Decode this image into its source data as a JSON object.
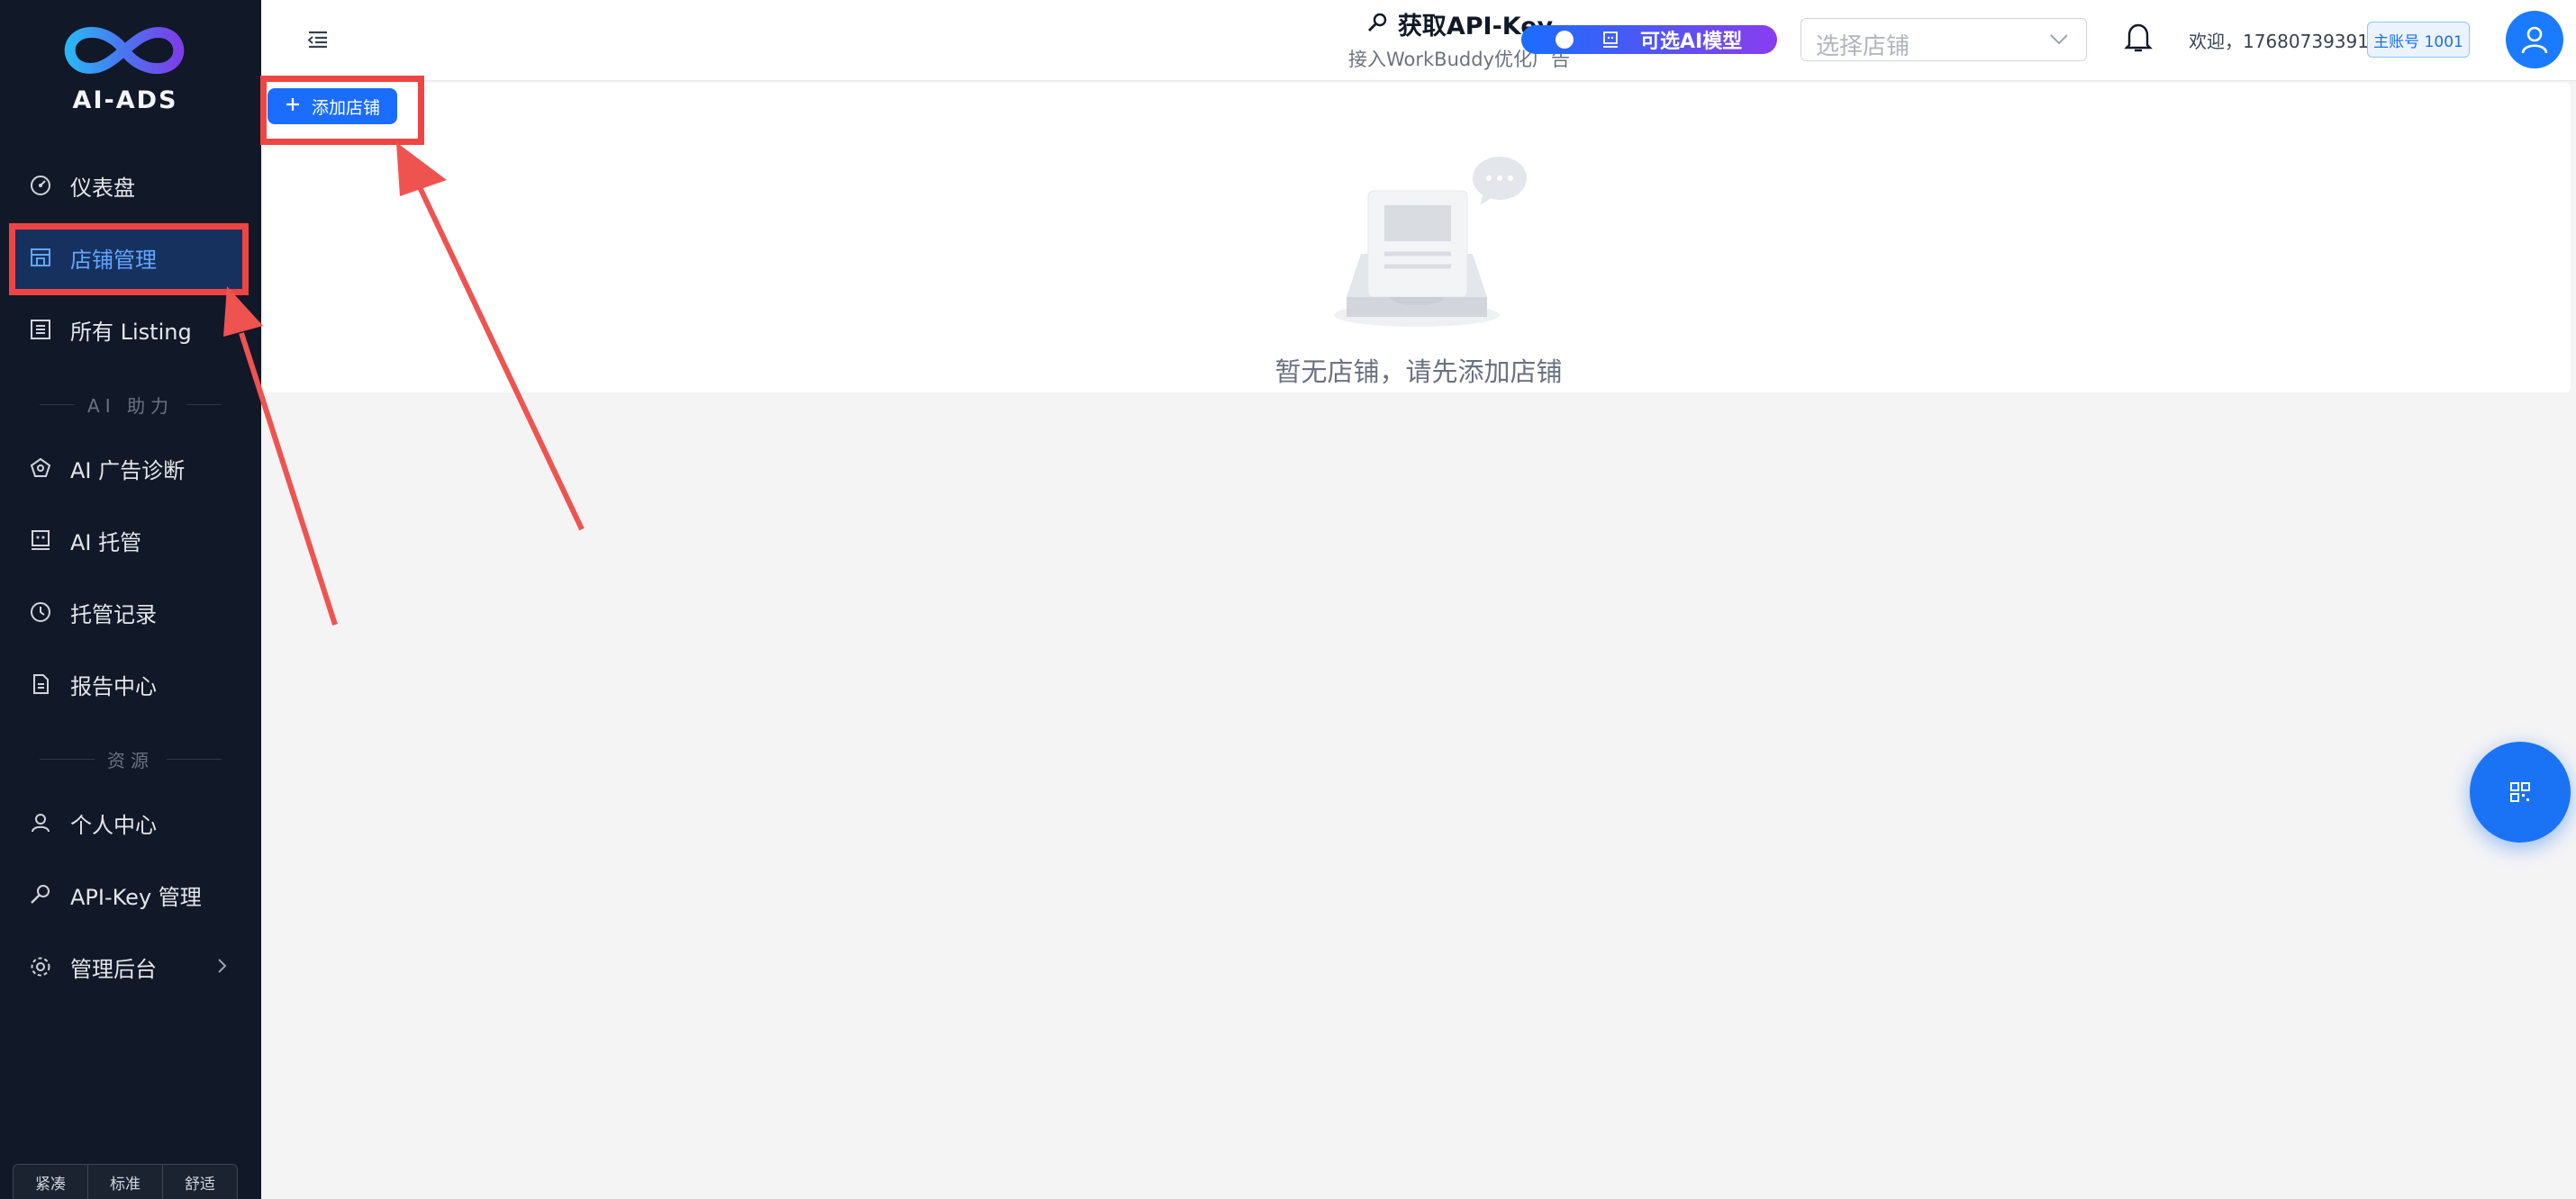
{
  "brand": {
    "name": "AI-ADS"
  },
  "sidebar": {
    "items": [
      {
        "label": "仪表盘",
        "icon": "dashboard-icon",
        "active": false
      },
      {
        "label": "店铺管理",
        "icon": "store-icon",
        "active": true
      },
      {
        "label": "所有 Listing",
        "icon": "list-icon",
        "active": false
      }
    ],
    "section_ai": "AI 助力",
    "ai_items": [
      {
        "label": "AI 广告诊断",
        "icon": "diagnosis-icon"
      },
      {
        "label": "AI 托管",
        "icon": "robot-icon"
      },
      {
        "label": "托管记录",
        "icon": "history-icon"
      },
      {
        "label": "报告中心",
        "icon": "report-icon"
      }
    ],
    "section_resources": "资源",
    "resource_items": [
      {
        "label": "个人中心",
        "icon": "user-icon"
      },
      {
        "label": "API-Key 管理",
        "icon": "key-icon"
      },
      {
        "label": "管理后台",
        "icon": "gear-icon"
      }
    ],
    "density_options": [
      "紧凑",
      "标准",
      "舒适"
    ]
  },
  "header": {
    "api_key_title": "获取API-Key",
    "api_key_subtitle": "接入WorkBuddy优化广告",
    "ai_model_label": "可选AI模型",
    "store_select_placeholder": "选择店铺",
    "welcome_text": "欢迎，17680739391",
    "account_badge": "主账号 1001"
  },
  "main": {
    "add_store_label": "添加店铺",
    "empty_text": "暂无店铺，请先添加店铺"
  },
  "colors": {
    "sidebar_bg": "#111827",
    "primary": "#1a6dff",
    "active_bg": "#17315e",
    "highlight": "#ef4444"
  }
}
